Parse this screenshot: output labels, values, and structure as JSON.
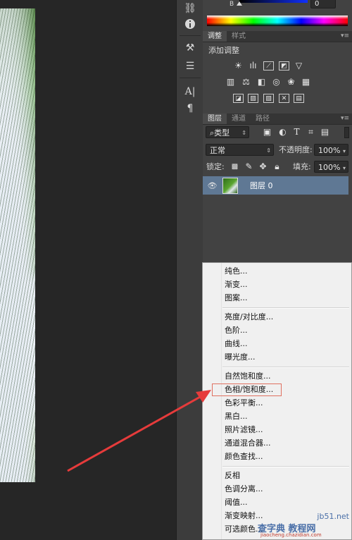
{
  "color_panel": {
    "channel_label": "B",
    "value": "0"
  },
  "adjustments": {
    "tabs": [
      "调整",
      "样式"
    ],
    "title": "添加调整",
    "icons": [
      "brightness-icon",
      "levels-icon",
      "curves-icon",
      "exposure-icon",
      "gradient-triangle-icon",
      "vibrance-icon",
      "balance-icon",
      "bw-icon",
      "camera-icon",
      "mixer-icon",
      "lookup-icon",
      "invert-icon",
      "posterize-icon",
      "threshold-icon",
      "gradient-map-icon",
      "selective-icon"
    ]
  },
  "layers": {
    "tabs": [
      "图层",
      "通道",
      "路径"
    ],
    "filter_label": "类型",
    "blend_mode": "正常",
    "opacity_label": "不透明度:",
    "opacity_value": "100%",
    "lock_label": "锁定:",
    "fill_label": "填充:",
    "fill_value": "100%",
    "layer_name": "图层 0"
  },
  "context_menu": {
    "groups": [
      [
        "纯色...",
        "渐变...",
        "图案..."
      ],
      [
        "亮度/对比度...",
        "色阶...",
        "曲线...",
        "曝光度..."
      ],
      [
        "自然饱和度...",
        "色相/饱和度...",
        "色彩平衡...",
        "黑白...",
        "照片滤镜...",
        "通道混合器...",
        "颜色查找..."
      ],
      [
        "反相",
        "色调分离...",
        "阈值...",
        "渐变映射...",
        "可选颜色..."
      ]
    ],
    "highlighted_item": "色相/饱和度..."
  },
  "watermark": {
    "line1": "查字典 教程网",
    "line2": "jiaocheng.chazidian.com",
    "site": "jb51.net"
  },
  "colors": {
    "arrow": "#e63b3b",
    "highlight_border": "#e07060",
    "panel_bg": "#424242"
  }
}
